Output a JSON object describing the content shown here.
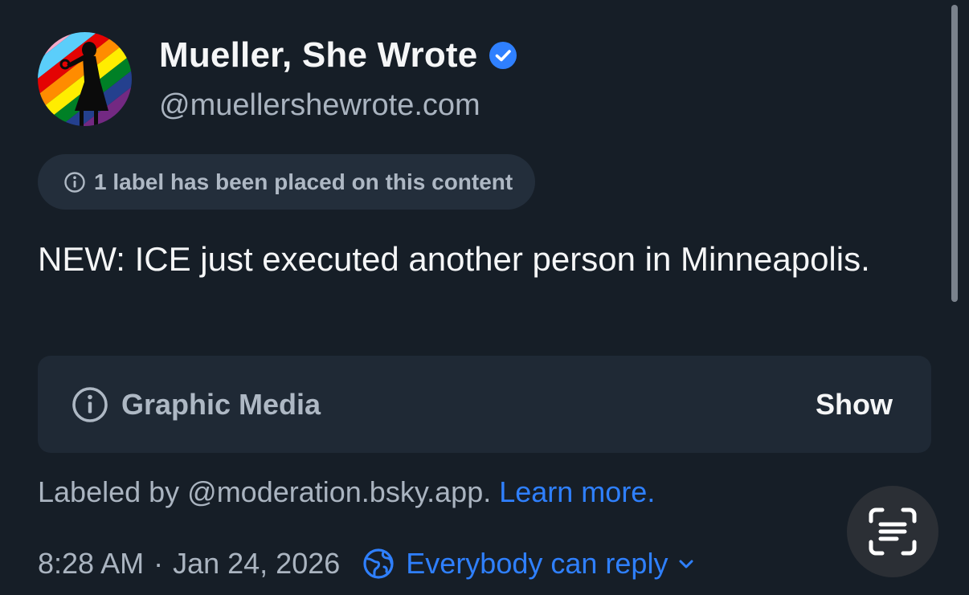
{
  "post": {
    "author_name": "Mueller, She Wrote",
    "handle": "@muellershewrote.com",
    "label_notice": "1 label has been placed on this content",
    "text": "NEW: ICE just executed another person in Minneapolis.",
    "media_warning": {
      "label": "Graphic Media",
      "button": "Show"
    },
    "labeled_by": "Labeled by @moderation.bsky.app.",
    "learn_more": "Learn more.",
    "time": "8:28 AM",
    "separator": "·",
    "date": "Jan 24, 2026",
    "reply_setting": "Everybody can reply"
  },
  "icons": {
    "verified": "verified-badge-icon",
    "info": "info-circle-icon",
    "globe": "globe-icon",
    "chevron": "chevron-down-icon",
    "text_scan": "text-scan-icon"
  },
  "colors": {
    "background": "#161e27",
    "accent": "#2f80ff",
    "muted_text": "#aab4c0",
    "card": "#1f2935",
    "pill": "#232e3b"
  }
}
